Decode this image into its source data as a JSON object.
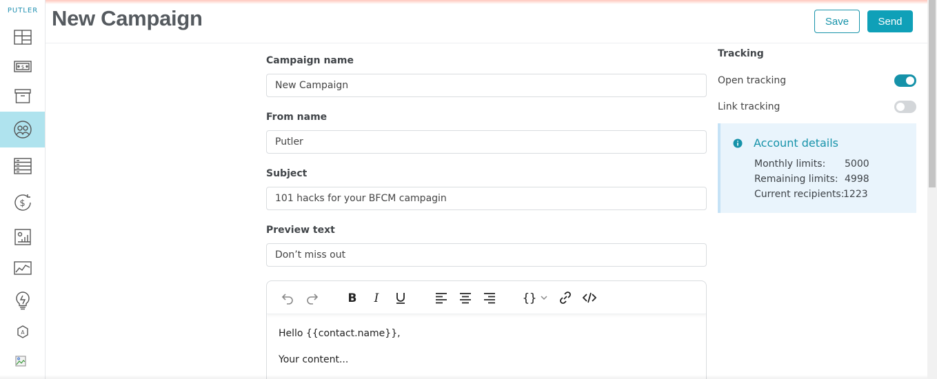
{
  "sidebar": {
    "brand": "PUTLER",
    "items": [
      {
        "icon": "dashboard-icon"
      },
      {
        "icon": "sales-icon"
      },
      {
        "icon": "products-icon"
      },
      {
        "icon": "customers-icon",
        "active": true
      },
      {
        "icon": "transactions-icon"
      },
      {
        "icon": "subscriptions-icon"
      },
      {
        "icon": "reports-icon"
      },
      {
        "icon": "insights-icon"
      },
      {
        "icon": "ideas-icon"
      },
      {
        "icon": "apps-icon"
      },
      {
        "icon": "avatar-image-icon"
      }
    ]
  },
  "header": {
    "title": "New Campaign",
    "save_label": "Save",
    "send_label": "Send"
  },
  "form": {
    "campaign_name": {
      "label": "Campaign name",
      "value": "New Campaign"
    },
    "from_name": {
      "label": "From name",
      "value": "Putler"
    },
    "subject": {
      "label": "Subject",
      "value": "101 hacks for your BFCM campagin"
    },
    "preview_text": {
      "label": "Preview text",
      "value": "Don’t miss out"
    }
  },
  "editor": {
    "lines": [
      "Hello {{contact.name}},",
      "Your content..."
    ]
  },
  "tracking": {
    "title": "Tracking",
    "open_tracking": {
      "label": "Open tracking",
      "enabled": true
    },
    "link_tracking": {
      "label": "Link tracking",
      "enabled": false
    }
  },
  "account": {
    "title": "Account details",
    "rows": [
      {
        "label": "Monthly limits:",
        "value": "5000"
      },
      {
        "label": "Remaining limits:",
        "value": "4998"
      },
      {
        "label": "Current recipients:",
        "value": "1223"
      }
    ]
  },
  "colors": {
    "accent": "#1592a9",
    "active_nav": "#afe3ee",
    "info_bg": "#e9f4fc"
  }
}
